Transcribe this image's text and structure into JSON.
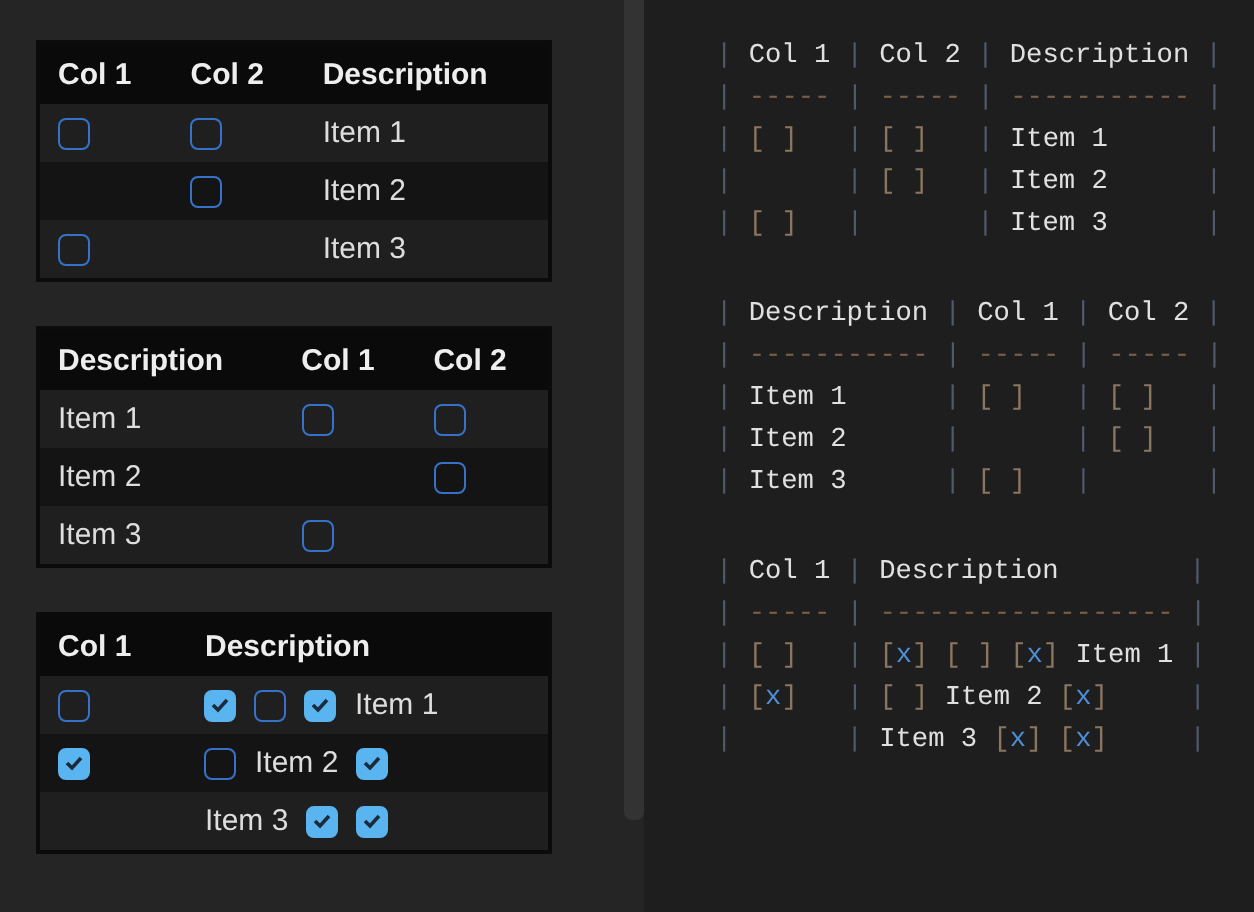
{
  "tables": [
    {
      "columns": [
        "Col 1",
        "Col 2",
        "Description"
      ],
      "rows": [
        {
          "cells": [
            {
              "parts": [
                {
                  "kind": "checkbox",
                  "checked": false
                }
              ]
            },
            {
              "parts": [
                {
                  "kind": "checkbox",
                  "checked": false
                }
              ]
            },
            {
              "parts": [
                {
                  "kind": "text",
                  "text": "Item 1"
                }
              ]
            }
          ]
        },
        {
          "cells": [
            {},
            {
              "parts": [
                {
                  "kind": "checkbox",
                  "checked": false
                }
              ]
            },
            {
              "parts": [
                {
                  "kind": "text",
                  "text": "Item 2"
                }
              ]
            }
          ]
        },
        {
          "cells": [
            {
              "parts": [
                {
                  "kind": "checkbox",
                  "checked": false
                }
              ]
            },
            {},
            {
              "parts": [
                {
                  "kind": "text",
                  "text": "Item 3"
                }
              ]
            }
          ]
        }
      ]
    },
    {
      "columns": [
        "Description",
        "Col 1",
        "Col 2"
      ],
      "rows": [
        {
          "cells": [
            {
              "parts": [
                {
                  "kind": "text",
                  "text": "Item 1"
                }
              ]
            },
            {
              "parts": [
                {
                  "kind": "checkbox",
                  "checked": false
                }
              ]
            },
            {
              "parts": [
                {
                  "kind": "checkbox",
                  "checked": false
                }
              ]
            }
          ]
        },
        {
          "cells": [
            {
              "parts": [
                {
                  "kind": "text",
                  "text": "Item 2"
                }
              ]
            },
            {},
            {
              "parts": [
                {
                  "kind": "checkbox",
                  "checked": false
                }
              ]
            }
          ]
        },
        {
          "cells": [
            {
              "parts": [
                {
                  "kind": "text",
                  "text": "Item 3"
                }
              ]
            },
            {
              "parts": [
                {
                  "kind": "checkbox",
                  "checked": false
                }
              ]
            },
            {}
          ]
        }
      ]
    },
    {
      "columns": [
        "Col 1",
        "Description"
      ],
      "rows": [
        {
          "cells": [
            {
              "parts": [
                {
                  "kind": "checkbox",
                  "checked": false
                }
              ]
            },
            {
              "parts": [
                {
                  "kind": "checkbox",
                  "checked": true
                },
                {
                  "kind": "checkbox",
                  "checked": false
                },
                {
                  "kind": "checkbox",
                  "checked": true
                },
                {
                  "kind": "text",
                  "text": "Item 1"
                }
              ]
            }
          ]
        },
        {
          "cells": [
            {
              "parts": [
                {
                  "kind": "checkbox",
                  "checked": true
                }
              ]
            },
            {
              "parts": [
                {
                  "kind": "checkbox",
                  "checked": false
                },
                {
                  "kind": "text",
                  "text": "Item 2"
                },
                {
                  "kind": "checkbox",
                  "checked": true
                }
              ]
            }
          ]
        },
        {
          "cells": [
            {},
            {
              "parts": [
                {
                  "kind": "text",
                  "text": "Item 3"
                },
                {
                  "kind": "checkbox",
                  "checked": true
                },
                {
                  "kind": "checkbox",
                  "checked": true
                }
              ]
            }
          ]
        }
      ]
    }
  ],
  "source_blocks": [
    {
      "lines": [
        "| Col 1 | Col 2 | Description |",
        "| ----- | ----- | ----------- |",
        "| [ ]   | [ ]   | Item 1      |",
        "|       | [ ]   | Item 2      |",
        "| [ ]   |       | Item 3      |"
      ]
    },
    {
      "lines": [
        "| Description | Col 1 | Col 2 |",
        "| ----------- | ----- | ----- |",
        "| Item 1      | [ ]   | [ ]   |",
        "| Item 2      |       | [ ]   |",
        "| Item 3      | [ ]   |       |"
      ]
    },
    {
      "lines": [
        "| Col 1 | Description        |",
        "| ----- | ------------------ |",
        "| [ ]   | [x] [ ] [x] Item 1 |",
        "| [x]   | [ ] Item 2 [x]     |",
        "|       | Item 3 [x] [x]     |"
      ]
    }
  ]
}
